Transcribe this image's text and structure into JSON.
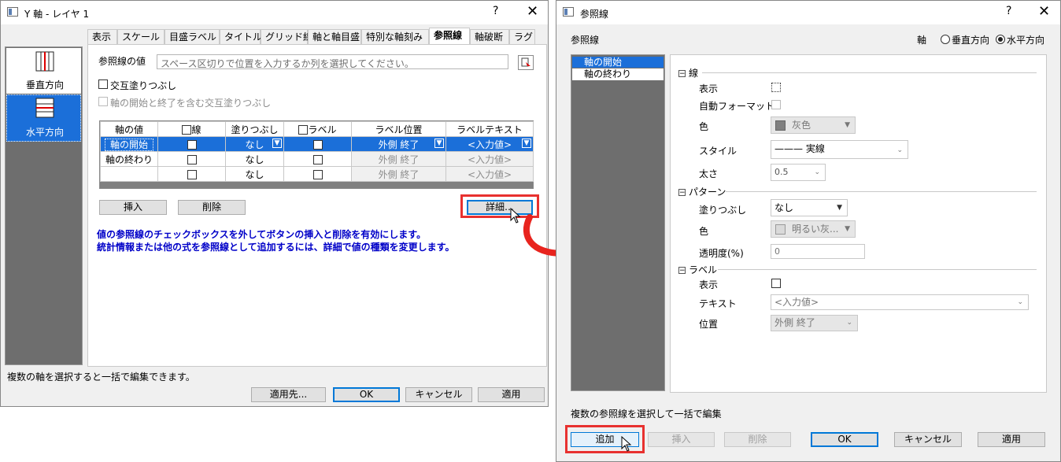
{
  "left_dialog": {
    "title": "Y 軸 - レイヤ 1",
    "help": "?",
    "close": "✕",
    "side_items": [
      "垂直方向",
      "水平方向"
    ],
    "tabs": [
      "表示",
      "スケール",
      "目盛ラベル",
      "タイトル",
      "グリッド線",
      "軸と軸目盛",
      "特別な軸刻み",
      "参照線",
      "軸破断",
      "ラグ"
    ],
    "active_tab": "参照線",
    "ref_value_label": "参照線の値",
    "ref_value_placeholder": "スペース区切りで位置を入力するか列を選択してください。",
    "alt_fill_label": "交互塗りつぶし",
    "alt_fill_include_label": "軸の開始と終了を含む交互塗りつぶし",
    "table": {
      "headers": [
        "軸の値",
        "線",
        "塗りつぶし",
        "ラベル",
        "ラベル位置",
        "ラベルテキスト"
      ],
      "rows": [
        {
          "axis_value": "軸の開始",
          "fill": "なし",
          "label_pos": "外側 終了",
          "label_text": "<入力値>"
        },
        {
          "axis_value": "軸の終わり",
          "fill": "なし",
          "label_pos": "外側 終了",
          "label_text": "<入力値>"
        },
        {
          "axis_value": "",
          "fill": "なし",
          "label_pos": "外側 終了",
          "label_text": "<入力値>"
        }
      ]
    },
    "insert_button": "挿入",
    "delete_button": "削除",
    "detail_button": "詳細…",
    "info_line1": "値の参照線のチェックボックスを外してボタンの挿入と削除を有効にします。",
    "info_line2": "統計情報または他の式を参照線として追加するには、詳細で値の種類を変更します。",
    "status_text": "複数の軸を選択すると一括で編集できます。",
    "apply_to_button": "適用先...",
    "ok_button": "OK",
    "cancel_button": "キャンセル",
    "apply_button": "適用"
  },
  "right_dialog": {
    "title": "参照線",
    "help": "?",
    "close": "✕",
    "header_label": "参照線",
    "axis_label": "軸",
    "vertical_option": "垂直方向",
    "horizontal_option": "水平方向",
    "list_items": [
      "軸の開始",
      "軸の終わり"
    ],
    "sections": {
      "line": {
        "title": "線",
        "show": "表示",
        "auto_format": "自動フォーマット",
        "color": "色",
        "color_value": "灰色",
        "style": "スタイル",
        "style_value": "——— 実線",
        "width": "太さ",
        "width_value": "0.5"
      },
      "pattern": {
        "title": "パターン",
        "fill": "塗りつぶし",
        "fill_value": "なし",
        "color": "色",
        "color_value": "明るい灰...",
        "transparency": "透明度(%)",
        "transparency_value": "0"
      },
      "label": {
        "title": "ラベル",
        "show": "表示",
        "text": "テキスト",
        "text_value": "<入力値>",
        "position": "位置",
        "position_value": "外側 終了"
      }
    },
    "status_text": "複数の参照線を選択して一括で編集",
    "add_button": "追加",
    "insert_button": "挿入",
    "delete_button": "削除",
    "ok_button": "OK",
    "cancel_button": "キャンセル",
    "apply_button": "適用"
  },
  "colors": {
    "highlight": "#e8312f",
    "selection": "#1b6fd9",
    "info_text": "#0000c8",
    "arrow": "#e8241e"
  }
}
